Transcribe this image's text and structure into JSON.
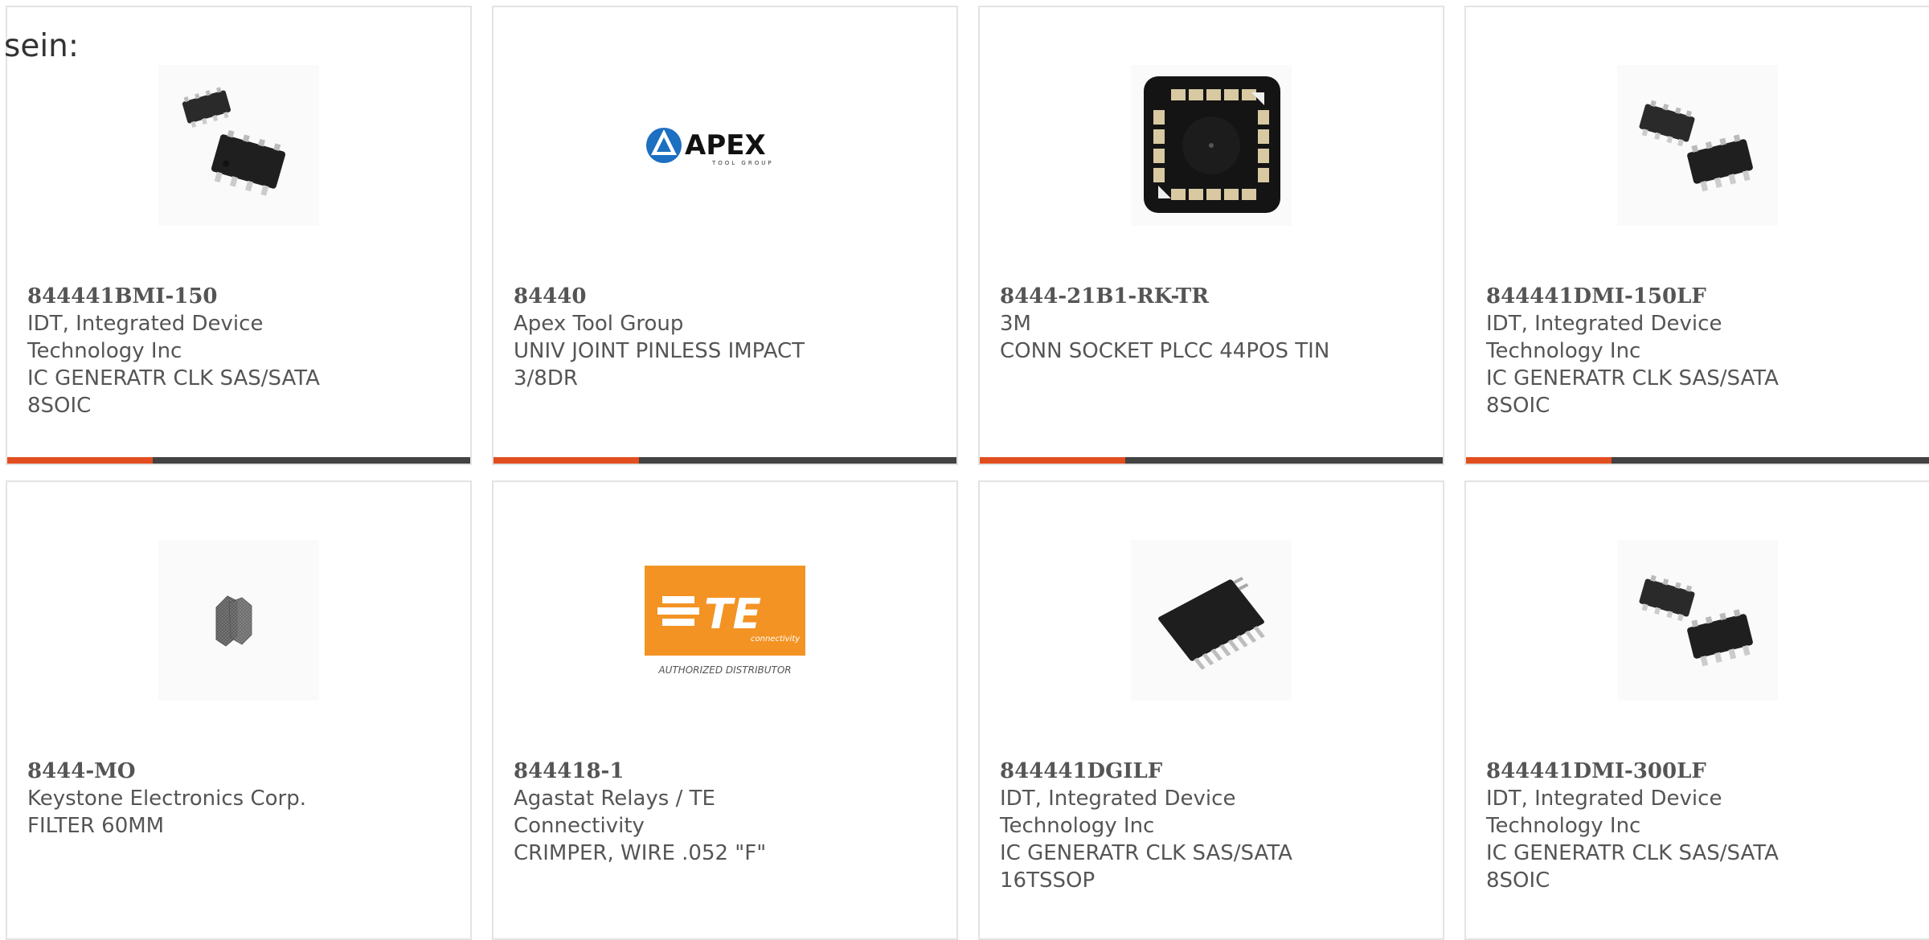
{
  "stray_text": "sein:",
  "colors": {
    "accent": "#e24e1f",
    "bar": "#424242",
    "border": "#e3e3e3",
    "text": "#555555"
  },
  "products": [
    {
      "part_number": "844441BMI-150",
      "manufacturer": "IDT, Integrated Device Technology Inc",
      "description": "IC GENERATR CLK SAS/SATA 8SOIC",
      "image": "soic-8-pair-image"
    },
    {
      "part_number": "84440",
      "manufacturer": "Apex Tool Group",
      "description": "UNIV JOINT PINLESS IMPACT 3/8DR",
      "image": "apex-tool-group-logo",
      "logo_text": "APEX",
      "logo_subtext": "TOOL GROUP"
    },
    {
      "part_number": "8444-21B1-RK-TR",
      "manufacturer": "3M",
      "description": "CONN SOCKET PLCC 44POS TIN",
      "image": "plcc-socket-image"
    },
    {
      "part_number": "844441DMI-150LF",
      "manufacturer": "IDT, Integrated Device Technology Inc",
      "description": "IC GENERATR CLK SAS/SATA 8SOIC",
      "image": "soic-8-pair-image"
    },
    {
      "part_number": "8444-MO",
      "manufacturer": "Keystone Electronics Corp.",
      "description": "FILTER 60MM",
      "image": "filter-mesh-image"
    },
    {
      "part_number": "844418-1",
      "manufacturer": "Agastat Relays / TE Connectivity",
      "description": "CRIMPER, WIRE .052 \"F\"",
      "image": "te-connectivity-logo",
      "logo_text": "TE",
      "logo_subtext": "connectivity",
      "logo_caption": "AUTHORIZED DISTRIBUTOR"
    },
    {
      "part_number": "844441DGILF",
      "manufacturer": "IDT, Integrated Device Technology Inc",
      "description": "IC GENERATR CLK SAS/SATA 16TSSOP",
      "image": "tssop-16-image"
    },
    {
      "part_number": "844441DMI-300LF",
      "manufacturer": "IDT, Integrated Device Technology Inc",
      "description": "IC GENERATR CLK SAS/SATA 8SOIC",
      "image": "soic-8-pair-image"
    }
  ]
}
